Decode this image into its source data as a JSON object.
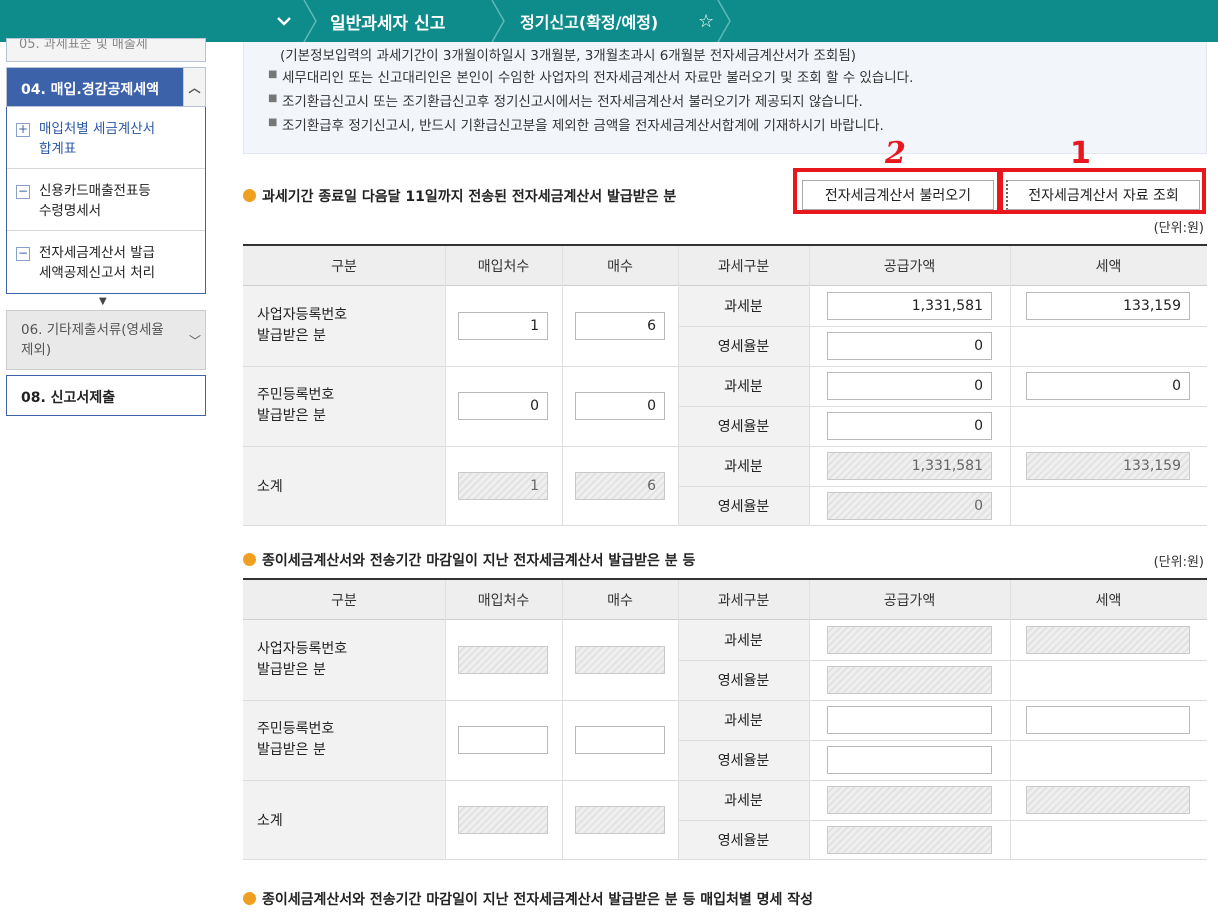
{
  "header": {
    "dropdown_icon": "chevron-down-icon",
    "crumb1": "일반과세자 신고",
    "crumb2": "정기신고(확정/예정)",
    "star_icon": "star-icon"
  },
  "sidebar": {
    "cut_item": "05. 과세표준 및 매출세",
    "item04": "04. 매입.경감공제세액",
    "sub_items": [
      {
        "icon": "plus",
        "line1": "매입처별 세금계산서",
        "line2": "합계표"
      },
      {
        "icon": "minus",
        "line1": "신용카드매출전표등",
        "line2": "수령명세서"
      },
      {
        "icon": "minus",
        "line1": "전자세금계산서 발급",
        "line2": "세액공제신고서 처리"
      }
    ],
    "item06_line1": "06.  기타제출서류(영세율",
    "item06_line2": "제외)",
    "item08": "08. 신고서제출"
  },
  "notice": {
    "lines": [
      "(기본정보입력의 과세기간이 3개월이하일시 3개월분, 3개월초과시 6개월분 전자세금계산서가 조회됨)",
      "세무대리인 또는 신고대리인은 본인이 수임한 사업자의 전자세금계산서 자료만 불러오기 및 조회 할 수 있습니다.",
      "조기환급신고시 또는 조기환급신고후 정기신고시에서는 전자세금계산서 불러오기가 제공되지 않습니다.",
      "조기환급후 정기신고시, 반드시 기환급신고분을 제외한 금액을 전자세금계산서합계에 기재하시기 바랍니다."
    ]
  },
  "section1": {
    "title": "과세기간 종료일 다음달 11일까지 전송된 전자세금계산서 발급받은 분",
    "btn_load": "전자세금계산서 불러오기",
    "btn_lookup": "전자세금계산서 자료 조회",
    "annot_load": "2",
    "annot_lookup": "1",
    "unit": "(단위:원)"
  },
  "table_headers": [
    "구분",
    "매입처수",
    "매수",
    "과세구분",
    "공급가액",
    "세액"
  ],
  "table1": {
    "row_labels": [
      {
        "line1": "사업자등록번호",
        "line2": "발급받은 분"
      },
      {
        "line1": "주민등록번호",
        "line2": "발급받은 분"
      },
      {
        "line1": "소계",
        "line2": ""
      }
    ],
    "type_taxable": "과세분",
    "type_zero": "영세율분",
    "biz": {
      "suppliers": "1",
      "count": "6",
      "taxable_amount": "1,331,581",
      "taxable_tax": "133,159",
      "zero_amount": "0"
    },
    "resident": {
      "suppliers": "0",
      "count": "0",
      "taxable_amount": "0",
      "taxable_tax": "0",
      "zero_amount": "0"
    },
    "subtotal": {
      "suppliers": "1",
      "count": "6",
      "taxable_amount": "1,331,581",
      "taxable_tax": "133,159",
      "zero_amount": "0"
    }
  },
  "section2": {
    "title": "종이세금계산서와 전송기간 마감일이 지난 전자세금계산서 발급받은 분 등",
    "unit": "(단위:원)"
  },
  "section3": {
    "title": "종이세금계산서와 전송기간 마감일이 지난 전자세금계산서 발급받은 분 등 매입처별 명세 작성"
  }
}
